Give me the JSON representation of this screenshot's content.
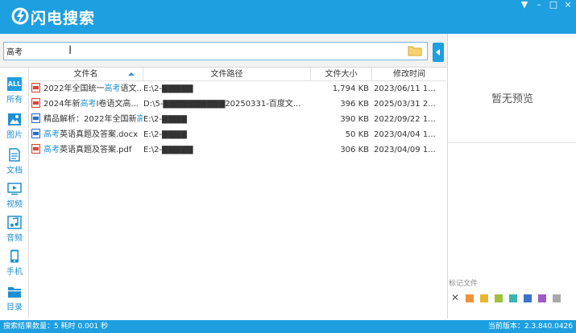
{
  "app": {
    "title": "闪电搜索",
    "accent": "#1e9fe0"
  },
  "window_controls": [
    "▼",
    "–",
    "□",
    "×"
  ],
  "search": {
    "value": "高考"
  },
  "sidebar": {
    "items": [
      {
        "label": "所有",
        "icon": "all-icon",
        "icon_text": "ALL",
        "active": true
      },
      {
        "label": "图片",
        "icon": "image-icon"
      },
      {
        "label": "文档",
        "icon": "document-icon"
      },
      {
        "label": "视频",
        "icon": "video-icon"
      },
      {
        "label": "音频",
        "icon": "audio-icon"
      },
      {
        "label": "手机",
        "icon": "phone-icon"
      },
      {
        "label": "目录",
        "icon": "folder-icon"
      }
    ]
  },
  "columns": {
    "name": "文件名",
    "path": "文件路径",
    "size": "文件大小",
    "modified": "修改时间"
  },
  "files": [
    {
      "type": "pdf",
      "name_pre": "2022年全国统一",
      "name_hl": "高考",
      "name_post": "语文...",
      "path": "E:\\2-▇▇▇▇▇",
      "size": "1,794 KB",
      "date": "2023/06/11 1..."
    },
    {
      "type": "pdf",
      "name_pre": "2024年新",
      "name_hl": "高考",
      "name_post": "I卷语文高...",
      "path": "D:\\5-▇▇▇▇▇▇▇▇▇▇20250331-百度文...",
      "size": "396 KB",
      "date": "2025/03/31 2..."
    },
    {
      "type": "doc",
      "name_pre": "精品解析：2022年全国新",
      "name_hl": "高",
      "name_post": "",
      "path": "E:\\2-▇▇▇▇",
      "size": "390 KB",
      "date": "2022/09/22 1..."
    },
    {
      "type": "doc",
      "name_pre": "",
      "name_hl": "高考",
      "name_post": "英语真题及答案.docx",
      "path": "E:\\2-▇▇▇▇",
      "size": "50 KB",
      "date": "2023/04/04 1..."
    },
    {
      "type": "pdf",
      "name_pre": "",
      "name_hl": "高考",
      "name_post": "英语真题及答案.pdf",
      "path": "E:\\2-▇▇▇▇▇",
      "size": "306 KB",
      "date": "2023/04/09 1..."
    }
  ],
  "preview": {
    "placeholder": "暂无预览"
  },
  "tags": {
    "label": "标记文件",
    "colors": [
      "#f0923a",
      "#e8b62f",
      "#9fc13a",
      "#3cb5b0",
      "#3a74c9",
      "#9b5cc4",
      "#a9a9a9"
    ]
  },
  "status": {
    "left": "搜索结果数量：5  耗时 0.001 秒",
    "right": "当前版本：2.3.840.0426"
  }
}
